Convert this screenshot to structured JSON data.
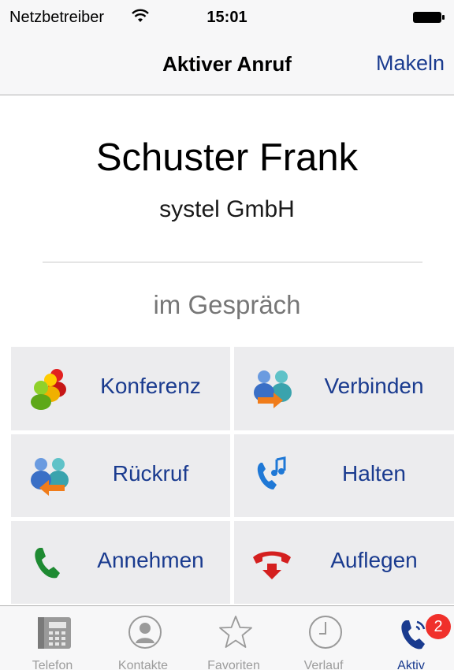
{
  "status_bar": {
    "carrier": "Netzbetreiber",
    "time": "15:01"
  },
  "nav": {
    "title": "Aktiver Anruf",
    "right_button": "Makeln"
  },
  "contact": {
    "name": "Schuster Frank",
    "company": "systel GmbH",
    "status": "im Gespräch"
  },
  "actions": [
    {
      "label": "Konferenz",
      "icon": "conference-icon"
    },
    {
      "label": "Verbinden",
      "icon": "transfer-icon"
    },
    {
      "label": "Rückruf",
      "icon": "callback-icon"
    },
    {
      "label": "Halten",
      "icon": "hold-music-icon"
    },
    {
      "label": "Annehmen",
      "icon": "accept-phone-icon"
    },
    {
      "label": "Auflegen",
      "icon": "hangup-phone-icon"
    }
  ],
  "tabs": [
    {
      "label": "Telefon",
      "icon": "dialpad-phone-icon"
    },
    {
      "label": "Kontakte",
      "icon": "contact-person-icon"
    },
    {
      "label": "Favoriten",
      "icon": "star-icon"
    },
    {
      "label": "Verlauf",
      "icon": "clock-icon"
    },
    {
      "label": "Aktiv",
      "icon": "active-call-icon",
      "active": true,
      "badge": "2"
    }
  ],
  "colors": {
    "accent": "#1a3b8f",
    "badge": "#f0302b",
    "cell_bg": "#ececee",
    "status_gray": "#777777"
  }
}
